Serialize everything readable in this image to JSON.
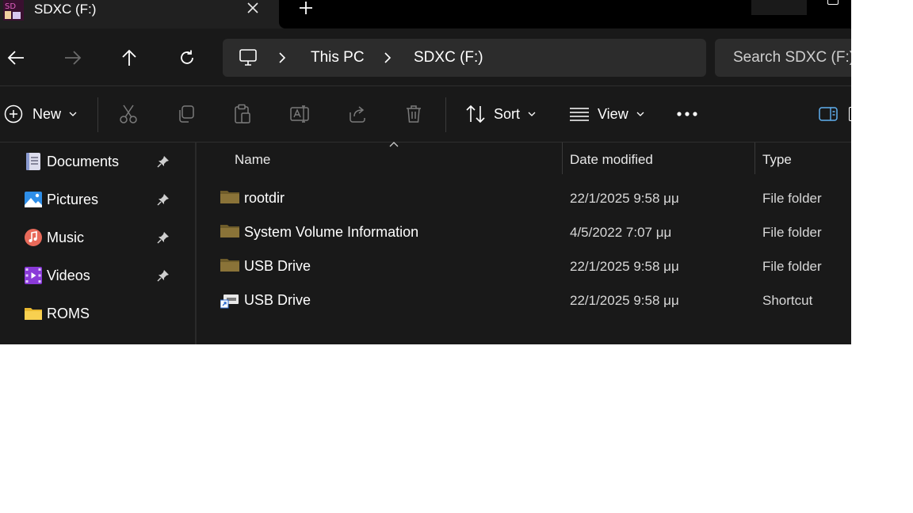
{
  "tab": {
    "title": "SDXC (F:)",
    "close_label": "✕",
    "new_tab_label": "+"
  },
  "nav": {
    "back_icon": "arrow-left-icon",
    "forward_icon": "arrow-right-icon",
    "up_icon": "arrow-up-icon",
    "refresh_icon": "refresh-icon"
  },
  "address": {
    "crumbs": [
      "This PC",
      "SDXC (F:)"
    ]
  },
  "search": {
    "placeholder": "Search SDXC (F:)"
  },
  "toolbar": {
    "new_label": "New",
    "sort_label": "Sort",
    "view_label": "View",
    "more_label": "•••"
  },
  "sidebar": {
    "items": [
      {
        "label": "Documents",
        "icon": "documents-icon",
        "pinned": true
      },
      {
        "label": "Pictures",
        "icon": "pictures-icon",
        "pinned": true
      },
      {
        "label": "Music",
        "icon": "music-icon",
        "pinned": true
      },
      {
        "label": "Videos",
        "icon": "videos-icon",
        "pinned": true
      },
      {
        "label": "ROMS",
        "icon": "folder-icon",
        "pinned": false
      }
    ]
  },
  "columns": {
    "name": "Name",
    "date": "Date modified",
    "type": "Type"
  },
  "files": [
    {
      "name": "rootdir",
      "date": "22/1/2025 9:58 μμ",
      "type": "File folder",
      "icon": "folder-icon"
    },
    {
      "name": "System Volume Information",
      "date": "4/5/2022 7:07 μμ",
      "type": "File folder",
      "icon": "folder-icon"
    },
    {
      "name": "USB Drive",
      "date": "22/1/2025 9:58 μμ",
      "type": "File folder",
      "icon": "folder-icon"
    },
    {
      "name": "USB Drive",
      "date": "22/1/2025 9:58 μμ",
      "type": "Shortcut",
      "icon": "shortcut-icon"
    }
  ],
  "colors": {
    "background": "#191919",
    "titlebar": "#202020",
    "field": "#2c2c2c",
    "folder": "#8a7338",
    "accent": "#60b0f0"
  }
}
